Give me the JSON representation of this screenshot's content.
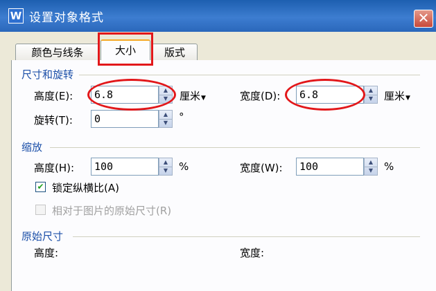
{
  "window": {
    "title": "设置对象格式",
    "app_icon": "W",
    "close_glyph": "✕"
  },
  "tabs": [
    {
      "label": "颜色与线条",
      "active": false
    },
    {
      "label": "大小",
      "active": true
    },
    {
      "label": "版式",
      "active": false
    }
  ],
  "size_rotate": {
    "heading": "尺寸和旋转",
    "height": {
      "label": "高度(E):",
      "value": "6.8",
      "unit": "厘米"
    },
    "width": {
      "label": "宽度(D):",
      "value": "6.8",
      "unit": "厘米"
    },
    "rotate": {
      "label": "旋转(T):",
      "value": "0",
      "unit": "°"
    }
  },
  "scale": {
    "heading": "缩放",
    "height": {
      "label": "高度(H):",
      "value": "100",
      "unit": "%"
    },
    "width": {
      "label": "宽度(W):",
      "value": "100",
      "unit": "%"
    },
    "lock_ratio": {
      "label": "锁定纵横比(A)",
      "checked": true
    },
    "relative": {
      "label": "相对于图片的原始尺寸(R)",
      "checked": false,
      "disabled": true
    }
  },
  "original": {
    "heading": "原始尺寸",
    "height_label": "高度:",
    "width_label": "宽度:"
  },
  "colors": {
    "accent": "#1b4fa8",
    "highlight": "#e2171a"
  }
}
